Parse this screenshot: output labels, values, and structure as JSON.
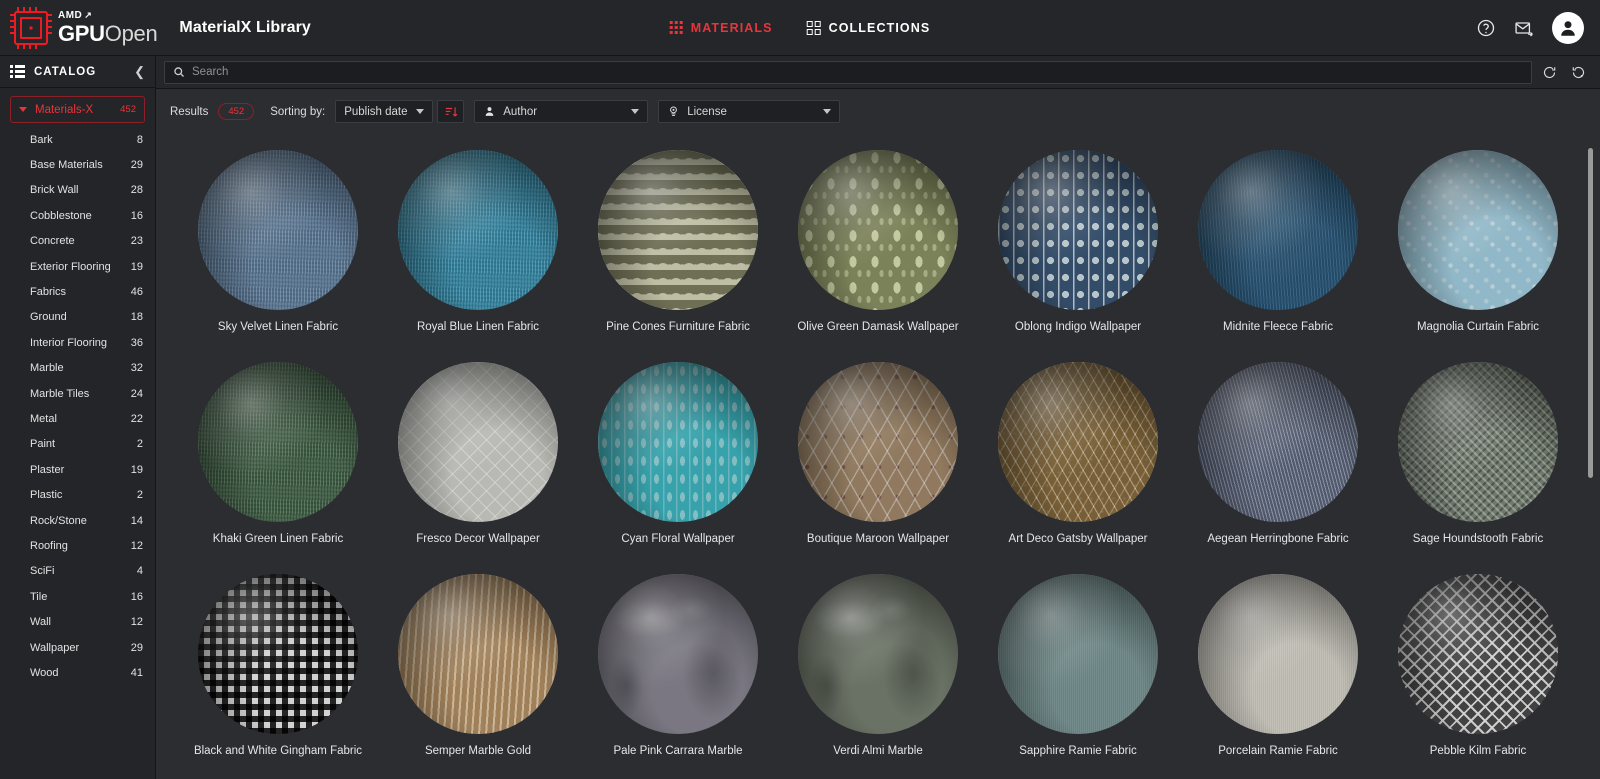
{
  "header": {
    "brand": {
      "amd": "AMD",
      "gpu": "GPU",
      "open": "Open"
    },
    "app_title": "MaterialX Library",
    "nav": [
      {
        "label": "MATERIALS",
        "icon": "dot-grid-icon",
        "active": true
      },
      {
        "label": "COLLECTIONS",
        "icon": "square-grid-icon",
        "active": false
      }
    ],
    "icons": [
      {
        "name": "help-icon"
      },
      {
        "name": "mail-icon"
      },
      {
        "name": "avatar"
      }
    ],
    "accent": "#E8353B"
  },
  "sidebar": {
    "title": "CATALOG",
    "collapse_icon": "chevron-left-icon",
    "root": {
      "label": "Materials-X",
      "count": "452"
    },
    "items": [
      {
        "label": "Bark",
        "count": "8"
      },
      {
        "label": "Base Materials",
        "count": "29"
      },
      {
        "label": "Brick Wall",
        "count": "28"
      },
      {
        "label": "Cobblestone",
        "count": "16"
      },
      {
        "label": "Concrete",
        "count": "23"
      },
      {
        "label": "Exterior Flooring",
        "count": "19"
      },
      {
        "label": "Fabrics",
        "count": "46"
      },
      {
        "label": "Ground",
        "count": "18"
      },
      {
        "label": "Interior Flooring",
        "count": "36"
      },
      {
        "label": "Marble",
        "count": "32"
      },
      {
        "label": "Marble Tiles",
        "count": "24"
      },
      {
        "label": "Metal",
        "count": "22"
      },
      {
        "label": "Paint",
        "count": "2"
      },
      {
        "label": "Plaster",
        "count": "19"
      },
      {
        "label": "Plastic",
        "count": "2"
      },
      {
        "label": "Rock/Stone",
        "count": "14"
      },
      {
        "label": "Roofing",
        "count": "12"
      },
      {
        "label": "SciFi",
        "count": "4"
      },
      {
        "label": "Tile",
        "count": "16"
      },
      {
        "label": "Wall",
        "count": "12"
      },
      {
        "label": "Wallpaper",
        "count": "29"
      },
      {
        "label": "Wood",
        "count": "41"
      }
    ]
  },
  "search": {
    "placeholder": "Search",
    "value": "",
    "icon": "search-icon",
    "actions": [
      {
        "name": "refresh-icon"
      },
      {
        "name": "reset-icon"
      }
    ]
  },
  "toolbar": {
    "results_label": "Results",
    "results_count": "452",
    "sorting_label": "Sorting by:",
    "sort_field": "Publish date",
    "sort_direction_icon": "sort-descending-icon",
    "author_filter": "Author",
    "author_icon": "person-icon",
    "license_filter": "License",
    "license_icon": "badge-icon"
  },
  "materials": [
    {
      "name": "Sky Velvet Linen Fabric",
      "base": "#6d90b4",
      "pattern": "linen"
    },
    {
      "name": "Royal Blue Linen Fabric",
      "base": "#3da0c4",
      "pattern": "linen"
    },
    {
      "name": "Pine Cones Furniture Fabric",
      "base": "#a9a98c",
      "pattern": "scallop"
    },
    {
      "name": "Olive Green Damask Wallpaper",
      "base": "#8d9466",
      "pattern": "damask"
    },
    {
      "name": "Oblong Indigo Wallpaper",
      "base": "#3b5878",
      "pattern": "beads"
    },
    {
      "name": "Midnite Fleece Fabric",
      "base": "#2f6288",
      "pattern": "fleece"
    },
    {
      "name": "Magnolia Curtain Fabric",
      "base": "#a6d2e4",
      "pattern": "floral"
    },
    {
      "name": "Khaki Green Linen Fabric",
      "base": "#4a7050",
      "pattern": "linen"
    },
    {
      "name": "Fresco Decor Wallpaper",
      "base": "#d3d3cd",
      "pattern": "diamondlite"
    },
    {
      "name": "Cyan Floral Wallpaper",
      "base": "#3fb9c4",
      "pattern": "leaf"
    },
    {
      "name": "Boutique Maroon Wallpaper",
      "base": "#a48a6b",
      "pattern": "harlequin"
    },
    {
      "name": "Art Deco Gatsby Wallpaper",
      "base": "#c9a86b",
      "pattern": "deco"
    },
    {
      "name": "Aegean Herringbone Fabric",
      "base": "#77839f",
      "pattern": "herringbone"
    },
    {
      "name": "Sage Houndstooth Fabric",
      "base": "#7e8a7b",
      "pattern": "houndstooth"
    },
    {
      "name": "Black and White Gingham Fabric",
      "base": "#dcdcdc",
      "pattern": "gingham"
    },
    {
      "name": "Semper Marble Gold",
      "base": "#d6b183",
      "pattern": "woodgrain"
    },
    {
      "name": "Pale Pink Carrara Marble",
      "base": "#8b8894",
      "pattern": "marble"
    },
    {
      "name": "Verdi Almi Marble",
      "base": "#798273",
      "pattern": "marble"
    },
    {
      "name": "Sapphire Ramie Fabric",
      "base": "#7f9b9b",
      "pattern": "plain"
    },
    {
      "name": "Porcelain Ramie Fabric",
      "base": "#dcd9cf",
      "pattern": "plain"
    },
    {
      "name": "Pebble Kilm Fabric",
      "base": "#5a5a5a",
      "pattern": "ikat"
    }
  ]
}
